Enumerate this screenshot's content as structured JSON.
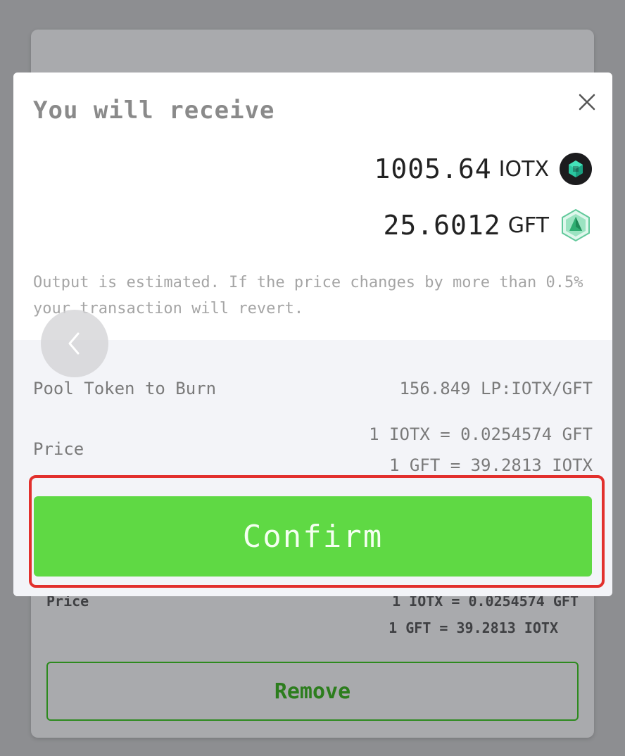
{
  "background": {
    "price_label": "Price",
    "price_line_1": "1 IOTX = 0.0254574 GFT",
    "price_line_2": "1 GFT = 39.2813 IOTX",
    "remove_label": "Remove"
  },
  "modal": {
    "title": "You will receive",
    "close_icon": "close-icon",
    "receive": [
      {
        "amount": "1005.64",
        "ticker": "IOTX",
        "icon": "iotx-token-icon"
      },
      {
        "amount": "25.6012",
        "ticker": "GFT",
        "icon": "gft-token-icon"
      }
    ],
    "estimate_note": "Output is estimated. If the price changes by more than 0.5% your transaction will revert.",
    "pool_label": "Pool Token to Burn",
    "pool_value": "156.849 LP:IOTX/GFT",
    "price_label": "Price",
    "price_line_1": "1 IOTX = 0.0254574 GFT",
    "price_line_2": "1 GFT = 39.2813 IOTX",
    "confirm_label": "Confirm"
  },
  "colors": {
    "confirm_green": "#5fd944",
    "highlight_red": "#e2302d",
    "remove_green": "#2c7d1d"
  }
}
